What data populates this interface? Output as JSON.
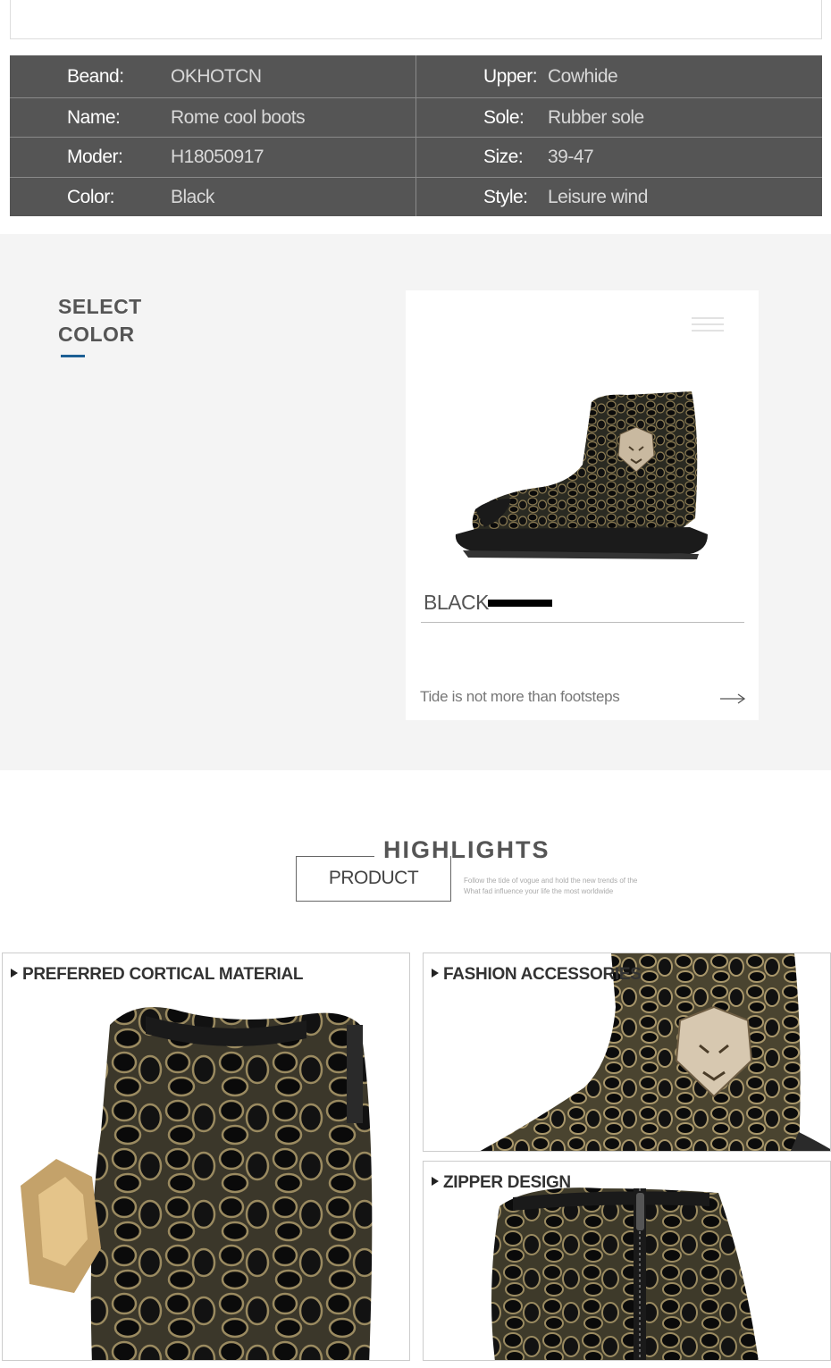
{
  "specs": {
    "rows": [
      {
        "left_key": "Beand:",
        "left_value": "OKHOTCN",
        "right_key": "Upper:",
        "right_value": "Cowhide"
      },
      {
        "left_key": "Name:",
        "left_value": "Rome cool boots",
        "right_key": "Sole:",
        "right_value": "Rubber sole"
      },
      {
        "left_key": "Moder:",
        "left_value": "H18050917",
        "right_key": "Size:",
        "right_value": "39-47"
      },
      {
        "left_key": "Color:",
        "left_value": "Black",
        "right_key": "Style:",
        "right_value": "Leisure wind"
      }
    ]
  },
  "select_color": {
    "title_line1": "SELECT",
    "title_line2": "COLOR",
    "accent_color": "#1c5f94",
    "card": {
      "color_name": "BLACK",
      "swatch_color": "#000000",
      "tagline": "Tide is not more than footsteps",
      "menu_icon": "hamburger-icon",
      "arrow_icon": "arrow-right-icon"
    }
  },
  "highlights": {
    "title": "HIGHLIGHTS",
    "subtitle": "PRODUCT",
    "caption_line1": "Follow the tide of vogue and hold the new trends of the",
    "caption_line2": "What fad influence your life the most worldwide"
  },
  "panels": [
    {
      "title": "PREFERRED CORTICAL MATERIAL"
    },
    {
      "title": "FASHION ACCESSORIES"
    },
    {
      "title": "ZIPPER DESIGN"
    }
  ]
}
